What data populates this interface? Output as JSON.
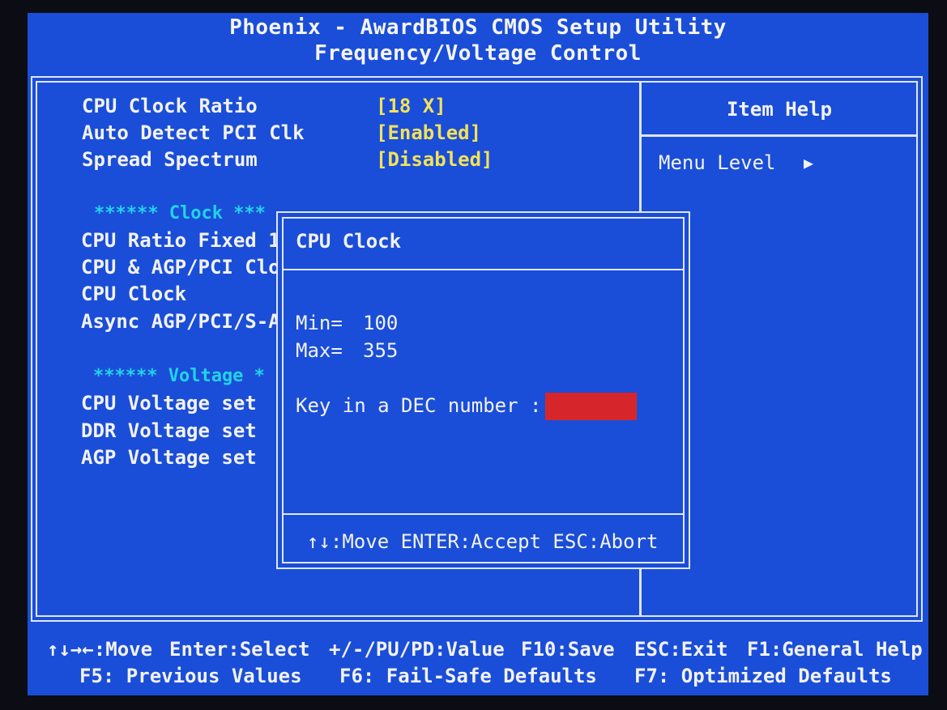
{
  "header": {
    "title": "Phoenix - AwardBIOS CMOS Setup Utility",
    "subtitle": "Frequency/Voltage Control"
  },
  "settings": [
    {
      "label": "CPU Clock Ratio",
      "value": "[18 X]"
    },
    {
      "label": "Auto Detect PCI Clk",
      "value": "[Enabled]"
    },
    {
      "label": "Spread Spectrum",
      "value": "[Disabled]"
    }
  ],
  "clock_section": {
    "title": "****** Clock ***",
    "items": [
      "CPU Ratio Fixed 1",
      "CPU & AGP/PCI Clo",
      "CPU Clock",
      "Async AGP/PCI/S-A"
    ]
  },
  "voltage_section": {
    "title": "****** Voltage *",
    "items": [
      "CPU Voltage set",
      "DDR Voltage set",
      "AGP Voltage set"
    ]
  },
  "help_panel": {
    "title": "Item Help",
    "menu_level": "Menu Level",
    "arrow": "▶"
  },
  "dialog": {
    "title": "CPU Clock",
    "min_label": "Min=",
    "min_value": "100",
    "max_label": "Max=",
    "max_value": "355",
    "prompt": "Key in a DEC number :",
    "input_value": "",
    "hint": "↑↓:Move ENTER:Accept ESC:Abort"
  },
  "footer": {
    "move": "↑↓→←:Move",
    "select": "Enter:Select",
    "value": "+/-/PU/PD:Value",
    "save": "F10:Save",
    "exit": "ESC:Exit",
    "help": "F1:General Help",
    "prev": "F5: Previous Values",
    "failsafe": "F6: Fail-Safe Defaults",
    "optimized": "F7: Optimized Defaults"
  },
  "colors": {
    "background": "#1a4ed8",
    "text": "#f2f2f2",
    "value": "#f2e25a",
    "section": "#22d3e8",
    "input": "#d7262b"
  }
}
